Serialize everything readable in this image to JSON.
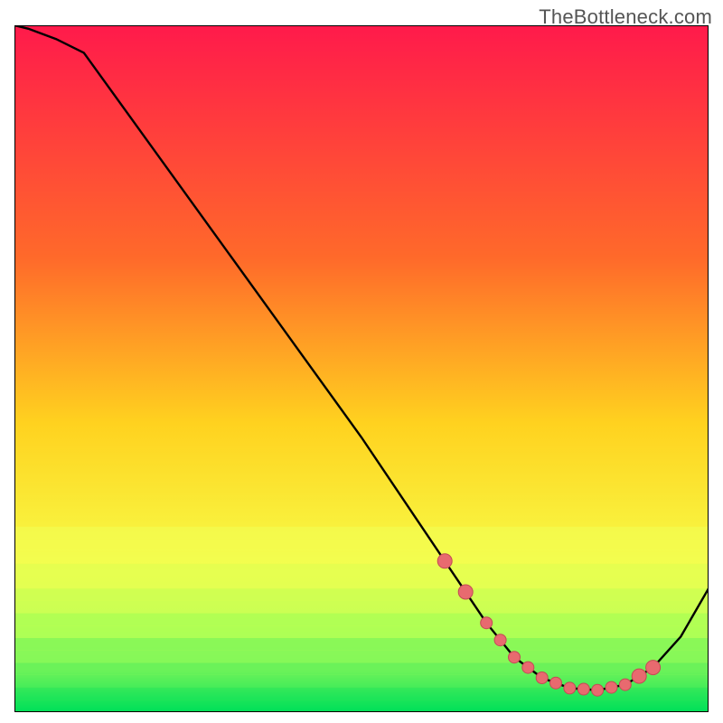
{
  "watermark": "TheBottleneck.com",
  "chart_data": {
    "type": "line",
    "title": "",
    "xlabel": "",
    "ylabel": "",
    "xlim": [
      0,
      100
    ],
    "ylim": [
      0,
      100
    ],
    "grid": false,
    "series": [
      {
        "name": "curve",
        "x": [
          0,
          2,
          6,
          10,
          20,
          30,
          40,
          50,
          58,
          64,
          68,
          72,
          76,
          80,
          84,
          88,
          92,
          96,
          100
        ],
        "y": [
          100,
          99.5,
          98,
          96,
          82,
          68,
          54,
          40,
          28,
          19,
          13,
          8,
          5,
          3.5,
          3.2,
          4.0,
          6.5,
          11,
          18
        ]
      }
    ],
    "marker_band": {
      "x_start": 62,
      "x_end": 92,
      "y_curve_offset": 0
    },
    "band_horizontal": {
      "start": 73,
      "end": 100
    },
    "colors": {
      "gradient_top": "#ff1a4b",
      "gradient_mid1": "#ff6a2a",
      "gradient_mid2": "#ffd21f",
      "gradient_mid3": "#f6ff4a",
      "gradient_bot": "#00e05a",
      "curve": "#000000",
      "marker_fill": "#e86a6f",
      "marker_stroke": "#c44b55"
    }
  }
}
